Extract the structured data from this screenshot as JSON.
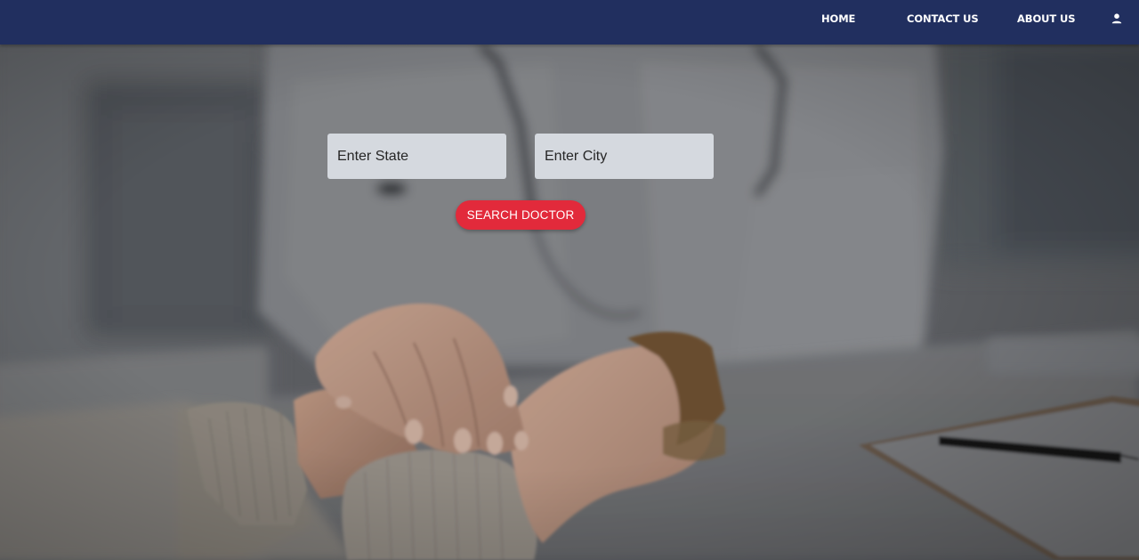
{
  "navbar": {
    "background": "#212f5f",
    "links": [
      {
        "label": "HOME"
      },
      {
        "label": "CONTACT US"
      },
      {
        "label": "ABOUT US"
      }
    ],
    "user_icon": "user-icon"
  },
  "search": {
    "state_placeholder": "Enter State",
    "city_placeholder": "Enter City",
    "state_value": "",
    "city_value": "",
    "button_label": "SEARCH DOCTOR",
    "button_color": "#e22a3b"
  },
  "hero": {
    "image": "doctor-holding-patient-hands-photo"
  }
}
